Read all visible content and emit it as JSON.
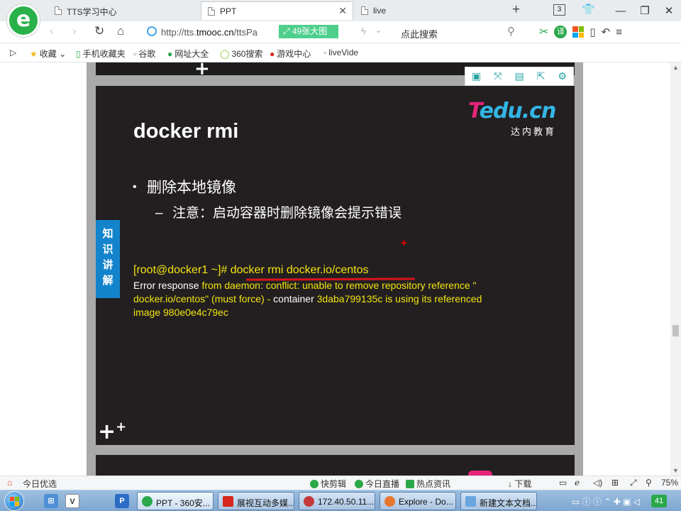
{
  "browser": {
    "tabs": [
      {
        "label": "TTS学习中心",
        "active": false
      },
      {
        "label": "PPT",
        "active": true
      },
      {
        "label": "live",
        "active": false
      }
    ],
    "tab_count": "3",
    "url_prefix": "http://tts.",
    "url_domain": "tmooc.cn",
    "url_suffix": "/ttsPa",
    "big_image_label": "49张大图",
    "search_placeholder": "点此搜索",
    "translate_label": "译",
    "brand_colors": {
      "green": "#2aa84a",
      "accent_green": "#4ecf8c"
    }
  },
  "bookmarks": [
    {
      "label": "收藏",
      "icon": "star-icon"
    },
    {
      "label": "手机收藏夹",
      "icon": "phone-icon"
    },
    {
      "label": "谷歌",
      "icon": "page-icon"
    },
    {
      "label": "网址大全",
      "icon": "sites-icon"
    },
    {
      "label": "360搜索",
      "icon": "search360-icon"
    },
    {
      "label": "游戏中心",
      "icon": "game-icon"
    },
    {
      "label": "liveVide",
      "icon": "page-icon"
    }
  ],
  "slide": {
    "brand_name_t": "T",
    "brand_name_rest": "edu.cn",
    "brand_sub": "达内教育",
    "title": "docker rmi",
    "bullet1": "删除本地镜像",
    "bullet2": "注意：启动容器时删除镜像会提示错误",
    "side_label": "知识讲解",
    "command": "[root@docker1 ~]# docker rmi docker.io/centos",
    "error_lines": [
      {
        "w": "Error response ",
        "y": "from daemon: conflict: unable to remove repository reference \""
      },
      {
        "w": "",
        "y": "docker.io/centos\" (must force) - "
      },
      {
        "w": "container ",
        "y": "3daba799135c  is using its referenced"
      },
      {
        "w": "",
        "y": "image 980e0e4c79ec"
      }
    ],
    "colors": {
      "bg": "#231f20",
      "yellow": "#f2e510",
      "side": "#1384cc",
      "underline": "#d8141c"
    }
  },
  "statusbar": {
    "left": "今日优选",
    "items": [
      "快剪辑",
      "今日直播",
      "热点资讯"
    ],
    "download": "下载",
    "zoom": "75%"
  },
  "taskbar": {
    "tasks": [
      {
        "label": "PPT - 360安...",
        "active": true
      },
      {
        "label": "展视互动多媒...",
        "active": false
      },
      {
        "label": "172.40.50.11...",
        "active": false
      },
      {
        "label": "Explore - Do...",
        "active": false
      },
      {
        "label": "新建文本文档...",
        "active": false
      }
    ],
    "tray_badge": "41"
  }
}
